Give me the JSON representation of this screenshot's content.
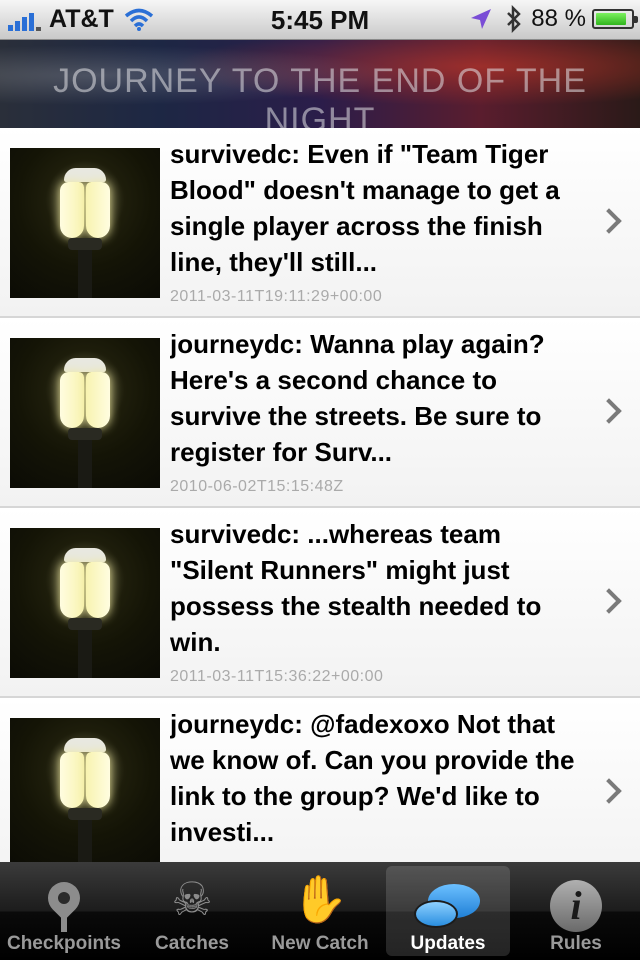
{
  "status_bar": {
    "carrier": "AT&T",
    "time": "5:45 PM",
    "battery_percent": "88 %",
    "battery_level": 0.88,
    "icons": [
      "signal-bars-icon",
      "wifi-icon",
      "location-arrow-icon",
      "bluetooth-icon",
      "battery-icon"
    ]
  },
  "banner": {
    "title": "JOURNEY TO THE END OF THE NIGHT"
  },
  "updates": [
    {
      "text": "survivedc: Even if \"Team Tiger Blood\" doesn't manage to get a single player across the finish line, they'll still...",
      "timestamp": "2011-03-11T19:11:29+00:00"
    },
    {
      "text": "journeydc: Wanna play again? Here's a second chance to survive the streets. Be sure to register for Surv...",
      "timestamp": "2010-06-02T15:15:48Z"
    },
    {
      "text": "survivedc: ...whereas team \"Silent Runners\" might just possess the stealth needed to win.",
      "timestamp": "2011-03-11T15:36:22+00:00"
    },
    {
      "text": "journeydc: @fadexoxo Not that we know of. Can you provide the link to the group? We'd like to investi...",
      "timestamp": ""
    }
  ],
  "tab_bar": {
    "active": "Updates",
    "tabs": [
      {
        "label": "Checkpoints",
        "icon": "map-pin-icon"
      },
      {
        "label": "Catches",
        "icon": "skull-crossbones-icon"
      },
      {
        "label": "New Catch",
        "icon": "hand-icon"
      },
      {
        "label": "Updates",
        "icon": "speech-bubbles-icon"
      },
      {
        "label": "Rules",
        "icon": "info-icon"
      }
    ]
  },
  "colors": {
    "active_tab_icon": "#3fa6f2",
    "signal_bars": "#2a6fd6",
    "timestamp_text": "#aaaaaa"
  }
}
